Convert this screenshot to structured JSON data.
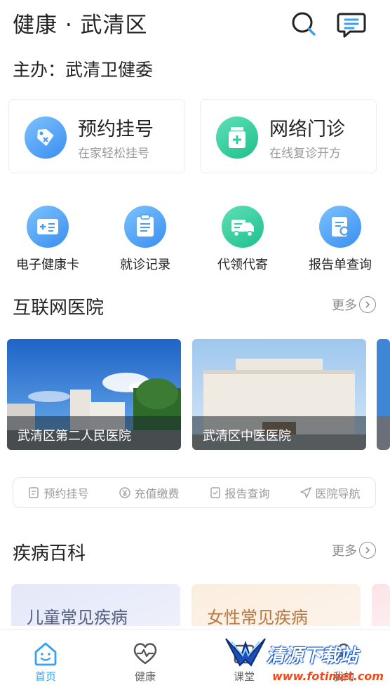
{
  "header": {
    "title": "健康 · 武清区"
  },
  "sponsor": "主办：武清卫健委",
  "main_cards": [
    {
      "title": "预约挂号",
      "subtitle": "在家轻松挂号"
    },
    {
      "title": "网络门诊",
      "subtitle": "在线复诊开方"
    }
  ],
  "quick_actions": [
    "电子健康卡",
    "就诊记录",
    "代领代寄",
    "报告单查询"
  ],
  "internet_hospital": {
    "title": "互联网医院",
    "more": "更多",
    "hospitals": [
      "武清区第二人民医院",
      "武清区中医医院"
    ]
  },
  "services": [
    "预约挂号",
    "充值缴费",
    "报告查询",
    "医院导航"
  ],
  "disease": {
    "title": "疾病百科",
    "more": "更多",
    "cards": [
      "儿童常见疾病",
      "女性常见疾病"
    ]
  },
  "tabs": [
    "首页",
    "健康",
    "课堂",
    "我的"
  ],
  "watermark": {
    "text": "清源下载站",
    "url": "www.fotimet.com"
  },
  "colors": {
    "accent_blue": "#3aa0f3",
    "green": "#2fcf9c",
    "gray_text": "#9a9a9a"
  }
}
